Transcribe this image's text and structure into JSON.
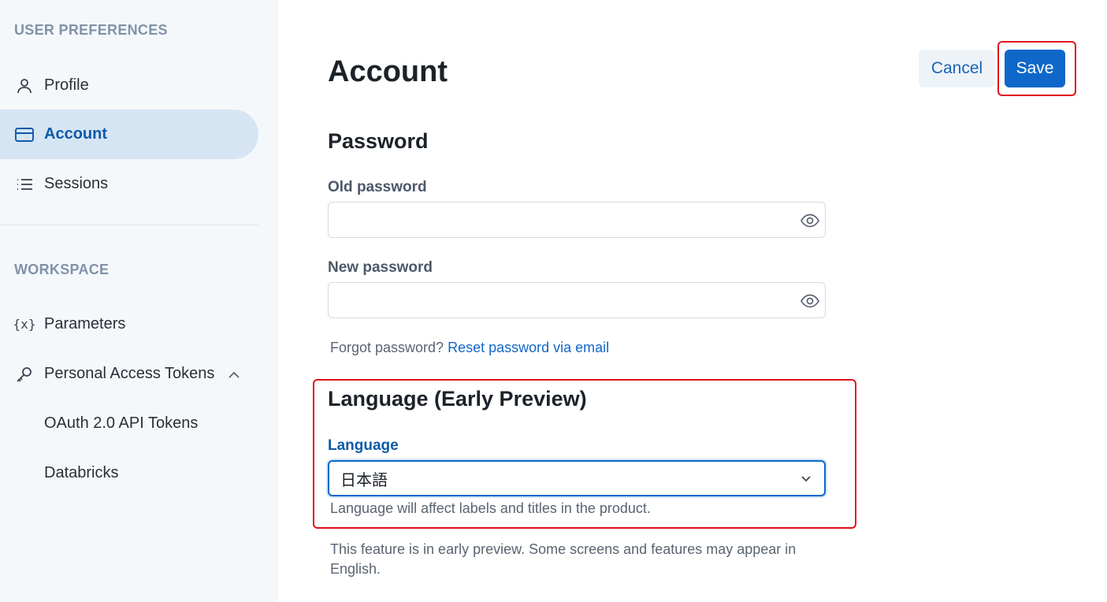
{
  "sidebar": {
    "user_section_title": "USER PREFERENCES",
    "workspace_section_title": "WORKSPACE",
    "items": [
      {
        "label": "Profile",
        "icon": "person-icon"
      },
      {
        "label": "Account",
        "icon": "card-icon",
        "active": true
      },
      {
        "label": "Sessions",
        "icon": "list-icon"
      },
      {
        "label": "Parameters",
        "icon": "variable-icon"
      },
      {
        "label": "Personal Access Tokens",
        "icon": "key-icon",
        "expanded": true
      }
    ],
    "sub_items": [
      "OAuth 2.0 API Tokens",
      "Databricks"
    ]
  },
  "header": {
    "title": "Account",
    "cancel_label": "Cancel",
    "save_label": "Save"
  },
  "password": {
    "heading": "Password",
    "old_label": "Old password",
    "old_value": "",
    "new_label": "New password",
    "new_value": "",
    "forgot_text": "Forgot password?",
    "reset_link": "Reset password via email"
  },
  "language": {
    "heading": "Language (Early Preview)",
    "label": "Language",
    "selected": "日本語",
    "helper": "Language will affect labels and titles in the product.",
    "note": "This feature is in early preview. Some screens and features may appear in English."
  },
  "colors": {
    "accent": "#0f67c9",
    "active_bg": "#d6e5f4",
    "highlight": "#e0101b"
  }
}
